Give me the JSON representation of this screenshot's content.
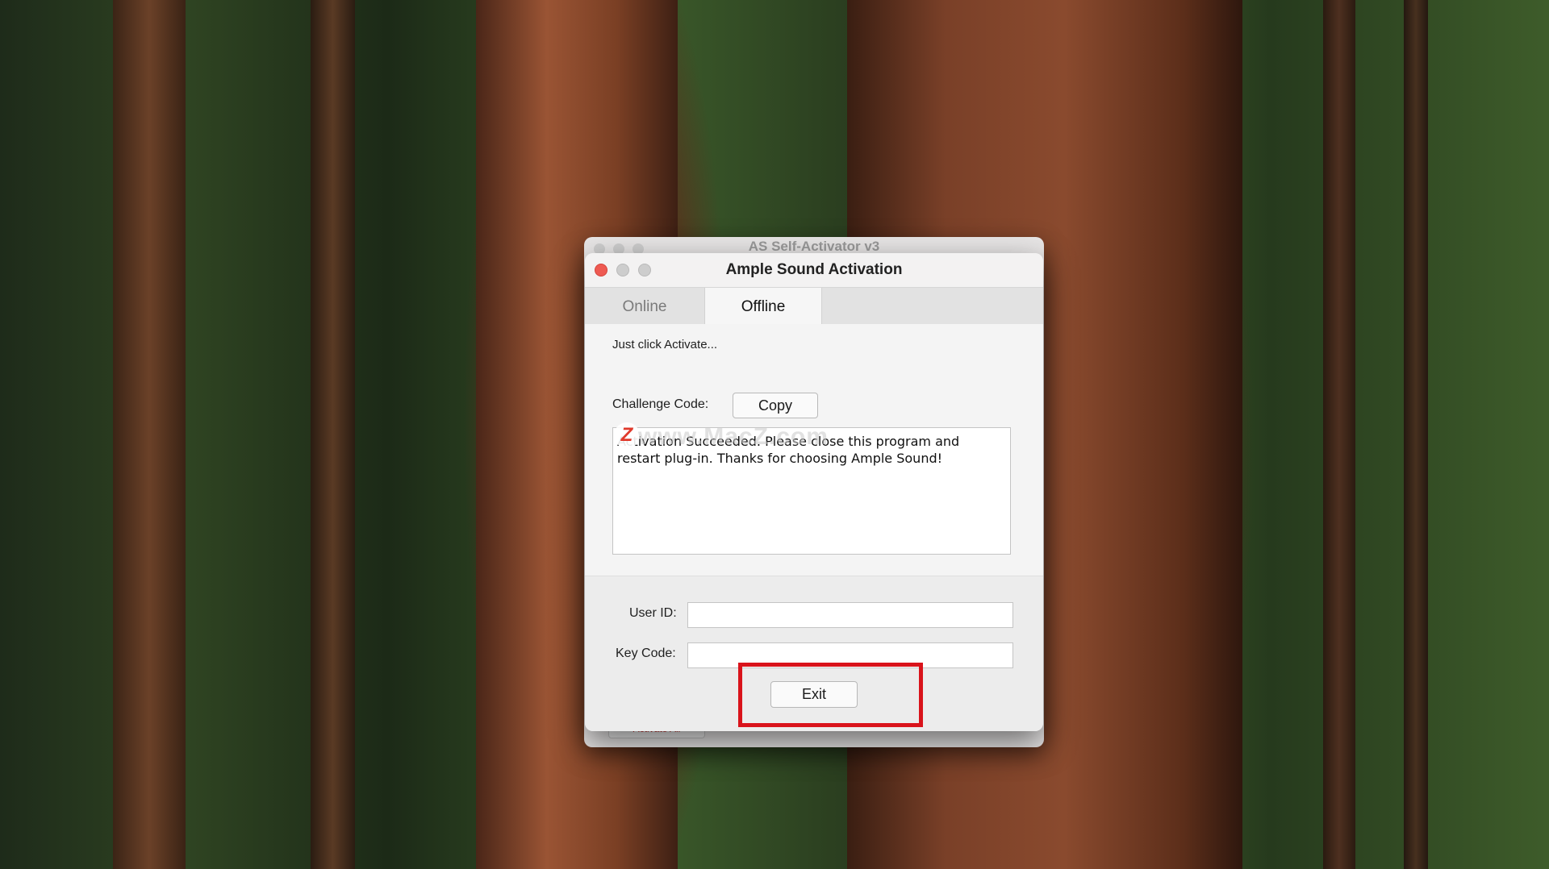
{
  "background": {
    "description_icon": "forest-wallpaper"
  },
  "back_window": {
    "title": "AS Self-Activator v3",
    "footer_button": "Activate All"
  },
  "window": {
    "title": "Ample Sound Activation",
    "tabs": [
      {
        "label": "Online",
        "selected": false
      },
      {
        "label": "Offline",
        "selected": true
      }
    ],
    "offline": {
      "hint": "Just click Activate...",
      "challenge_label": "Challenge Code:",
      "copy_label": "Copy",
      "result_text": "Activation Succeeded. Please close this program and restart plug-in. Thanks for choosing Ample Sound!",
      "watermark": "www.MacZ.com",
      "watermark_logo": "Z"
    },
    "user_id_label": "User ID:",
    "user_id_value": "",
    "key_code_label": "Key Code:",
    "key_code_value": "",
    "exit_label": "Exit"
  },
  "colors": {
    "close_red": "#ee5a52",
    "highlight_red": "#d9131b"
  }
}
